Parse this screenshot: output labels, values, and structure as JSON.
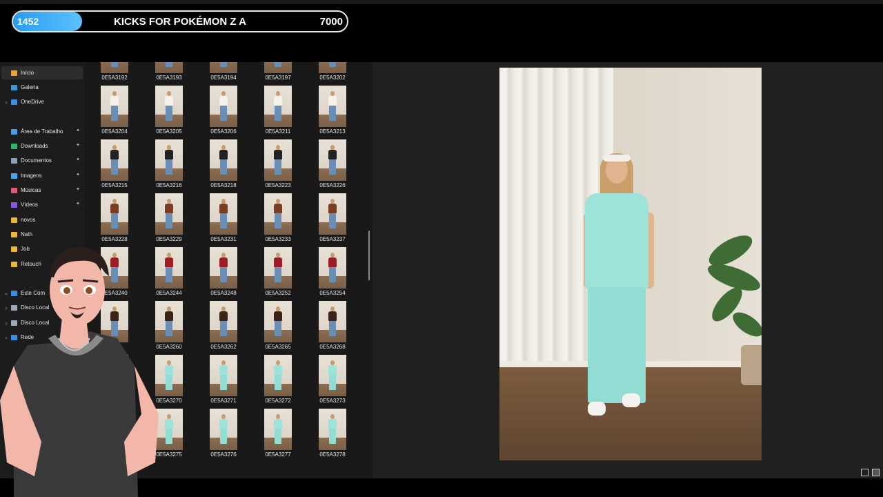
{
  "stream_goal": {
    "current": "1452",
    "title": "KICKS FOR POKÉMON Z A",
    "target": "7000",
    "progress_fraction": 0.2074,
    "fill_color": "#2a9bf0"
  },
  "sidebar": {
    "items": [
      {
        "label": "Início",
        "icon": "home-icon",
        "color": "#e8a33d",
        "active": true,
        "chevron": false,
        "pinned": false
      },
      {
        "label": "Galeria",
        "icon": "gallery-icon",
        "color": "#3a9ad9",
        "active": false,
        "chevron": false,
        "pinned": false
      },
      {
        "label": "OneDrive",
        "icon": "cloud-icon",
        "color": "#3b8fe0",
        "active": false,
        "chevron": true,
        "pinned": false
      },
      {
        "label": "Área de Trabalho",
        "icon": "desktop-icon",
        "color": "#4a9fe0",
        "active": false,
        "chevron": false,
        "pinned": true
      },
      {
        "label": "Downloads",
        "icon": "download-icon",
        "color": "#35b36a",
        "active": false,
        "chevron": false,
        "pinned": true
      },
      {
        "label": "Documentos",
        "icon": "document-icon",
        "color": "#8aa0b8",
        "active": false,
        "chevron": false,
        "pinned": true
      },
      {
        "label": "Imagens",
        "icon": "image-icon",
        "color": "#4aa6e8",
        "active": false,
        "chevron": false,
        "pinned": true
      },
      {
        "label": "Músicas",
        "icon": "music-icon",
        "color": "#e0587a",
        "active": false,
        "chevron": false,
        "pinned": true
      },
      {
        "label": "Vídeos",
        "icon": "video-icon",
        "color": "#8a5ad9",
        "active": false,
        "chevron": false,
        "pinned": true
      },
      {
        "label": "novos",
        "icon": "folder-icon",
        "color": "#e8b83d",
        "active": false,
        "chevron": false,
        "pinned": false
      },
      {
        "label": "Nath",
        "icon": "folder-icon",
        "color": "#e8b83d",
        "active": false,
        "chevron": false,
        "pinned": false
      },
      {
        "label": "Job",
        "icon": "folder-icon",
        "color": "#e8b83d",
        "active": false,
        "chevron": false,
        "pinned": false
      },
      {
        "label": "Retouch",
        "icon": "folder-icon",
        "color": "#e8b83d",
        "active": false,
        "chevron": false,
        "pinned": false
      },
      {
        "label": "Este Com",
        "icon": "computer-icon",
        "color": "#3b8fe0",
        "active": false,
        "chevron": true,
        "pinned": false
      },
      {
        "label": "Disco Local",
        "icon": "drive-icon",
        "color": "#9aa8b8",
        "active": false,
        "chevron": true,
        "pinned": false
      },
      {
        "label": "Disco Local",
        "icon": "drive-icon",
        "color": "#9aa8b8",
        "active": false,
        "chevron": true,
        "pinned": false
      },
      {
        "label": "Rede",
        "icon": "network-icon",
        "color": "#3b8fe0",
        "active": false,
        "chevron": true,
        "pinned": false
      }
    ]
  },
  "files": {
    "rows": [
      [
        {
          "name": "0E5A3192",
          "top": "#7aa0c8"
        },
        {
          "name": "0E5A3193",
          "top": "#7aa0c8"
        },
        {
          "name": "0E5A3194",
          "top": "#f0b8c8"
        },
        {
          "name": "0E5A3197",
          "top": "#f0b8c8"
        },
        {
          "name": "0E5A3202",
          "top": "#f0b8c8"
        }
      ],
      [
        {
          "name": "0E5A3204",
          "top": "#f4f0ea"
        },
        {
          "name": "0E5A3205",
          "top": "#f4f0ea"
        },
        {
          "name": "0E5A3206",
          "top": "#f4f0ea"
        },
        {
          "name": "0E5A3211",
          "top": "#f4f0ea"
        },
        {
          "name": "0E5A3213",
          "top": "#f4f0ea"
        }
      ],
      [
        {
          "name": "0E5A3215",
          "top": "#222222"
        },
        {
          "name": "0E5A3216",
          "top": "#222222"
        },
        {
          "name": "0E5A3218",
          "top": "#222222"
        },
        {
          "name": "0E5A3223",
          "top": "#222222"
        },
        {
          "name": "0E5A3226",
          "top": "#222222"
        }
      ],
      [
        {
          "name": "0E5A3228",
          "top": "#7a3e22"
        },
        {
          "name": "0E5A3229",
          "top": "#7a3e22"
        },
        {
          "name": "0E5A3231",
          "top": "#7a3e22"
        },
        {
          "name": "0E5A3233",
          "top": "#7a3e22"
        },
        {
          "name": "0E5A3237",
          "top": "#7a3e22"
        }
      ],
      [
        {
          "name": "0E5A3240",
          "top": "#9e1c24"
        },
        {
          "name": "0E5A3244",
          "top": "#9e1c24"
        },
        {
          "name": "0E5A3248",
          "top": "#9e1c24"
        },
        {
          "name": "0E5A3252",
          "top": "#9e1c24"
        },
        {
          "name": "0E5A3254",
          "top": "#9e1c24"
        }
      ],
      [
        {
          "name": "",
          "top": "#3a2418"
        },
        {
          "name": "0E5A3260",
          "top": "#3a2418"
        },
        {
          "name": "0E5A3262",
          "top": "#3a2418"
        },
        {
          "name": "0E5A3265",
          "top": "#3a2418"
        },
        {
          "name": "0E5A3268",
          "top": "#3a2418"
        }
      ],
      [
        {
          "name": "",
          "top": "#9ee3d9"
        },
        {
          "name": "0E5A3270",
          "top": "#9ee3d9"
        },
        {
          "name": "0E5A3271",
          "top": "#9ee3d9"
        },
        {
          "name": "0E5A3272",
          "top": "#9ee3d9"
        },
        {
          "name": "0E5A3273",
          "top": "#9ee3d9"
        }
      ],
      [
        {
          "name": "74",
          "top": "#9ee3d9"
        },
        {
          "name": "0E5A3275",
          "top": "#9ee3d9"
        },
        {
          "name": "0E5A3276",
          "top": "#9ee3d9"
        },
        {
          "name": "0E5A3277",
          "top": "#9ee3d9"
        },
        {
          "name": "0E5A3278",
          "top": "#9ee3d9"
        }
      ]
    ]
  },
  "preview": {
    "outfit_color": "#9ee3d9"
  },
  "view_buttons": [
    {
      "icon": "details-view-icon",
      "active": false
    },
    {
      "icon": "preview-view-icon",
      "active": true
    }
  ]
}
